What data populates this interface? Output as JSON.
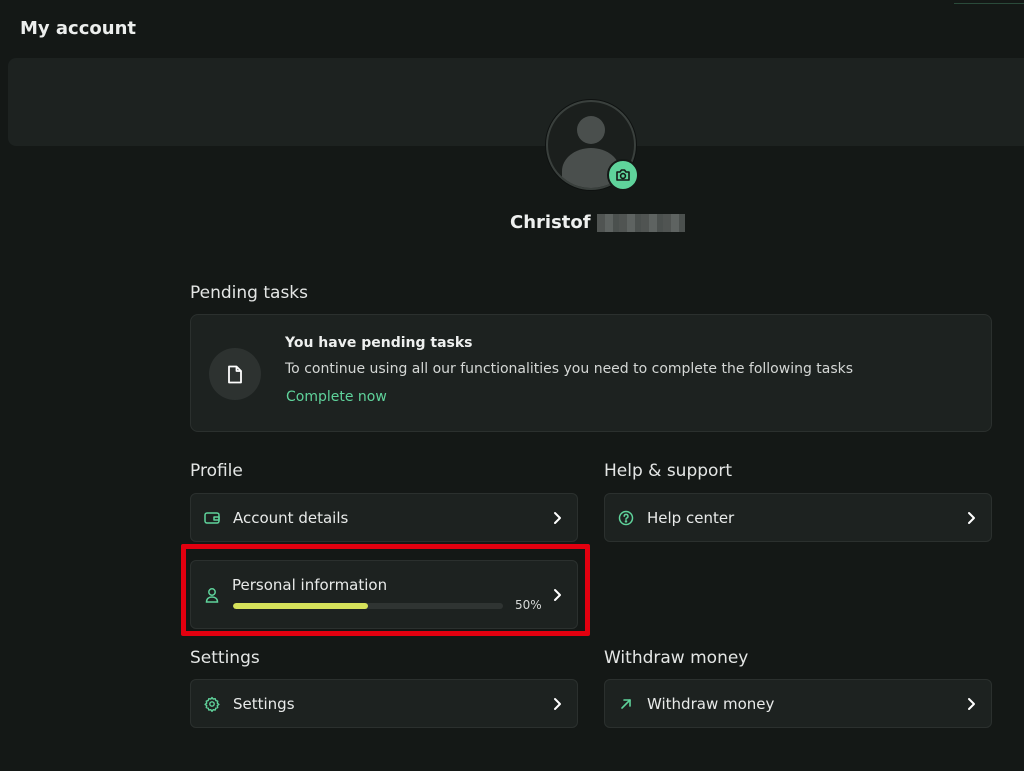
{
  "header": {
    "title": "My account"
  },
  "profile_card": {
    "first_name": "Christof",
    "avatar_icon": "user-avatar-icon",
    "camera_icon": "camera-icon"
  },
  "pending": {
    "section_title": "Pending tasks",
    "heading": "You have pending tasks",
    "description": "To continue using all our functionalities you need to complete the following tasks",
    "action_label": "Complete now",
    "icon": "document-icon"
  },
  "profile": {
    "section_title": "Profile",
    "account_details_label": "Account details",
    "personal_info_label": "Personal information",
    "personal_info_progress": 50,
    "personal_info_progress_text": "50%"
  },
  "help": {
    "section_title": "Help & support",
    "help_center_label": "Help center"
  },
  "settings": {
    "section_title": "Settings",
    "settings_label": "Settings"
  },
  "withdraw": {
    "section_title": "Withdraw money",
    "withdraw_label": "Withdraw money"
  },
  "colors": {
    "accent": "#5fd39b",
    "progress": "#d6e25a",
    "background": "#141816",
    "card": "#1d2220",
    "highlight": "#e3000f"
  }
}
